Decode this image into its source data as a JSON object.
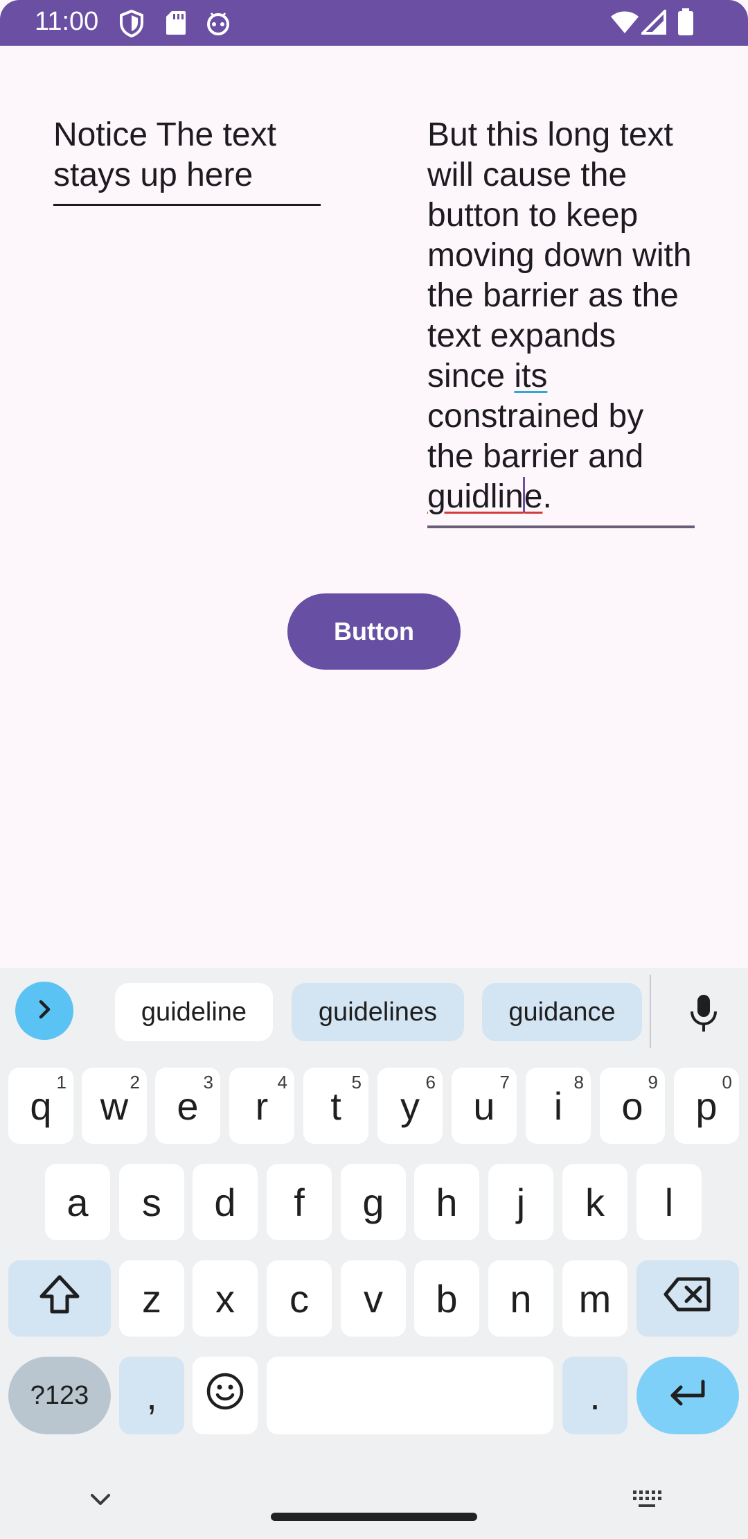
{
  "status_bar": {
    "time": "11:00",
    "left_icons": [
      "shield-icon",
      "sd-card-icon",
      "android-face-icon"
    ],
    "right_icons": [
      "wifi-icon",
      "signal-icon",
      "battery-icon"
    ],
    "color": "#6a4fa3"
  },
  "content": {
    "left_field_text": "Notice The text stays up here",
    "right_field": {
      "part1": "But this long text will cause the button to keep moving down with the barrier as the text expands since ",
      "underlined_word": "its",
      "part2": " constrained by the barrier and ",
      "typo_before_cursor": "guidlin",
      "typo_after_cursor": "e",
      "end": "."
    },
    "button_label": "Button",
    "button_color": "#6750a4"
  },
  "keyboard": {
    "suggestions": [
      "guideline",
      "guidelines",
      "guidance"
    ],
    "row1": [
      {
        "key": "q",
        "hint": "1"
      },
      {
        "key": "w",
        "hint": "2"
      },
      {
        "key": "e",
        "hint": "3"
      },
      {
        "key": "r",
        "hint": "4"
      },
      {
        "key": "t",
        "hint": "5"
      },
      {
        "key": "y",
        "hint": "6"
      },
      {
        "key": "u",
        "hint": "7"
      },
      {
        "key": "i",
        "hint": "8"
      },
      {
        "key": "o",
        "hint": "9"
      },
      {
        "key": "p",
        "hint": "0"
      }
    ],
    "row2": [
      "a",
      "s",
      "d",
      "f",
      "g",
      "h",
      "j",
      "k",
      "l"
    ],
    "row3": [
      "z",
      "x",
      "c",
      "v",
      "b",
      "n",
      "m"
    ],
    "symbols_label": "?123",
    "comma_label": ",",
    "period_label": ".",
    "accent_color": "#7fd0f8"
  },
  "nav": {
    "icons": [
      "chevron-down-icon",
      "keyboard-icon"
    ]
  }
}
